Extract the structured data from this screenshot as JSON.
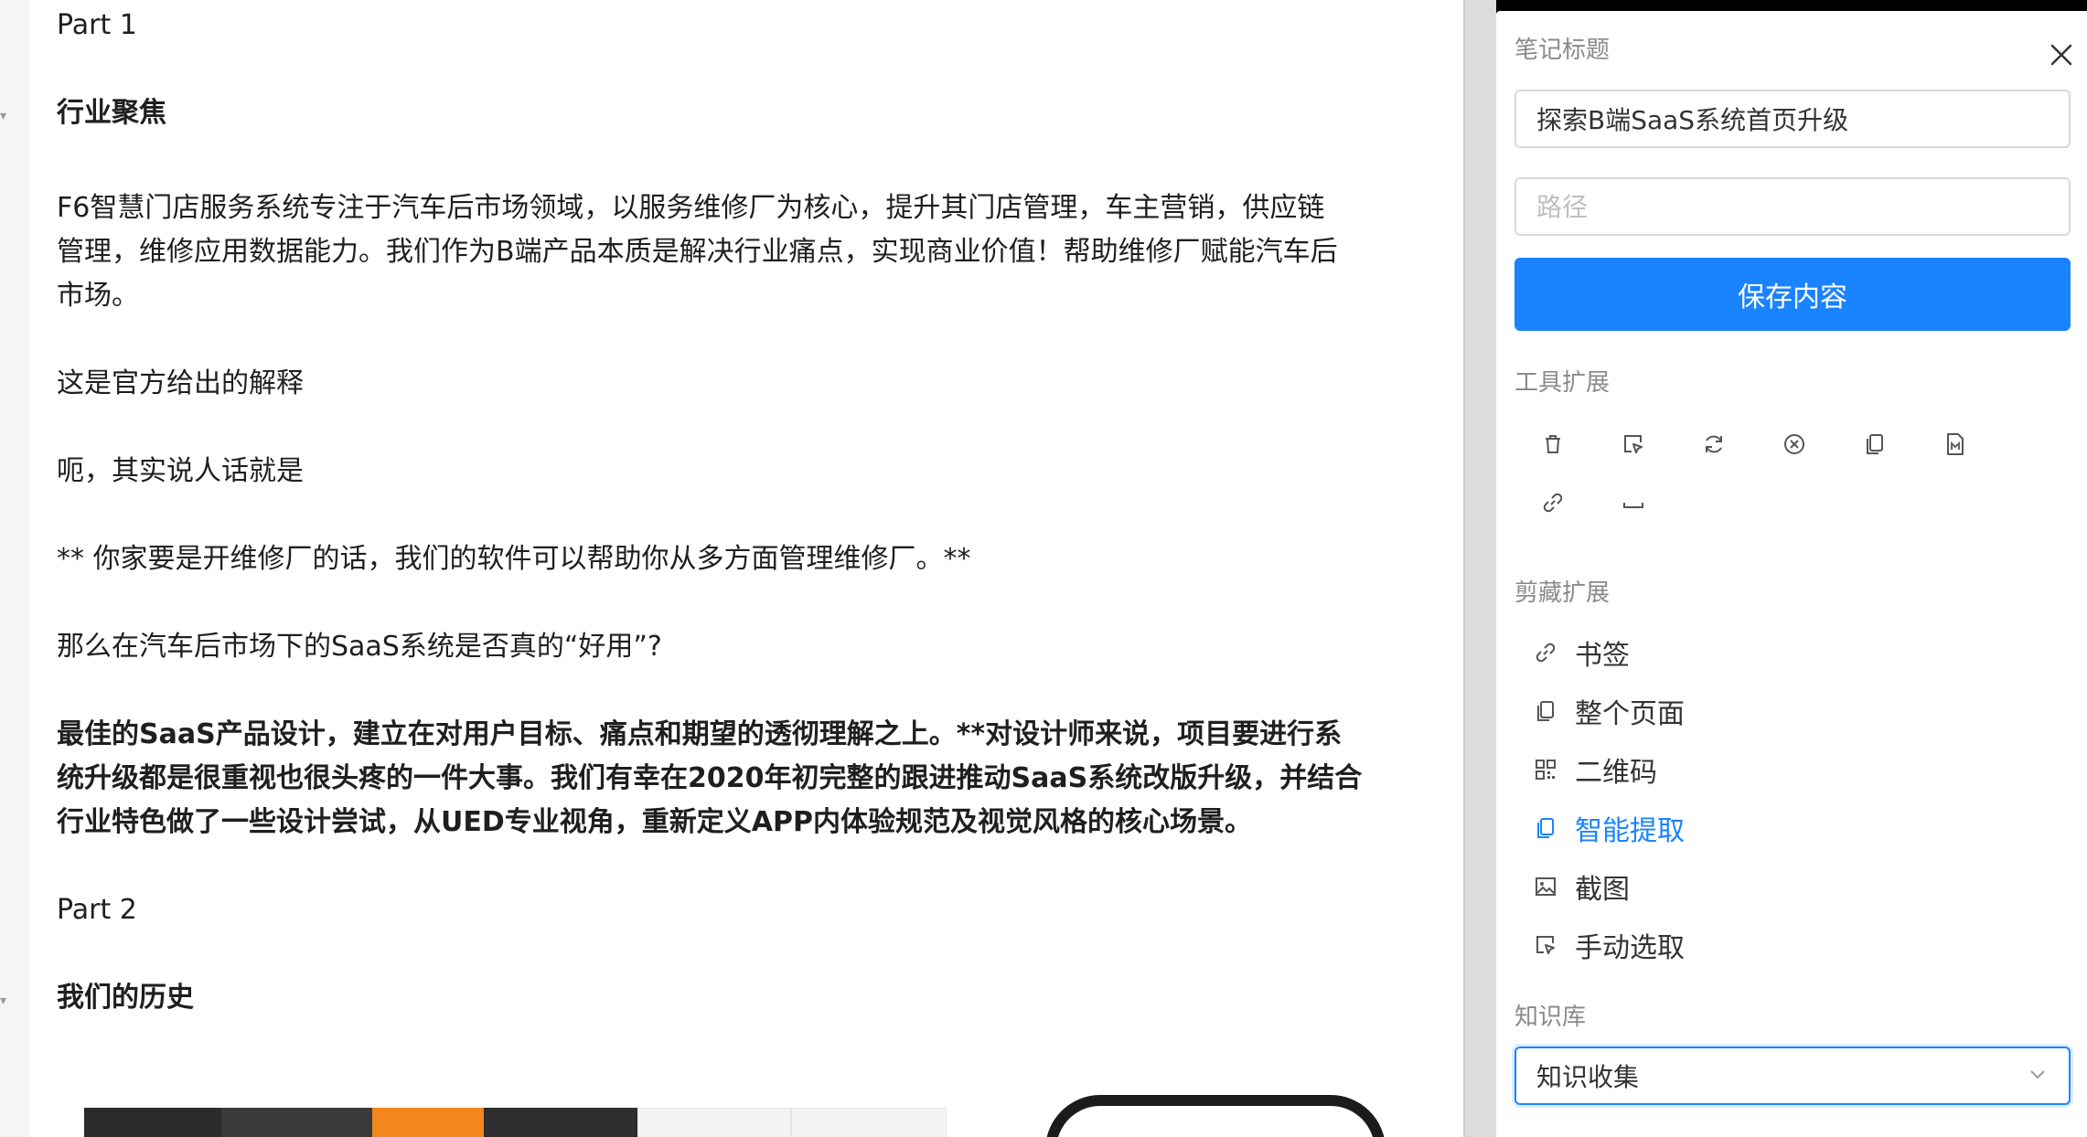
{
  "doc": {
    "part1": "Part 1",
    "heading1": "行业聚焦",
    "para1_line1": "F6智慧门店服务系统专注于汽车后市场领域，以服务维修厂为核心，提升其门店管理，车主营销，供应链",
    "para1_line2": "管理，维修应用数据能力。我们作为B端产品本质是解决行业痛点，实现商业价值！帮助维修厂赋能汽车后",
    "para1_line3": "市场。",
    "para2": "这是官方给出的解释",
    "para3": "呃，其实说人话就是",
    "para4": "** 你家要是开维修厂的话，我们的软件可以帮助你从多方面管理维修厂。**",
    "para5": "那么在汽车后市场下的SaaS系统是否真的“好用”?",
    "para6_line1": "最佳的SaaS产品设计，建立在对用户目标、痛点和期望的透彻理解之上。**对设计师来说，项目要进行系",
    "para6_line2": "统升级都是很重视也很头疼的一件大事。我们有幸在2020年初完整的跟进推动SaaS系统改版升级，并结合",
    "para6_line3": "行业特色做了一些设计尝试，从UED专业视角，重新定义APP内体验规范及视觉风格的核心场景。",
    "part2": "Part 2",
    "heading2": "我们的历史"
  },
  "panel": {
    "note_title_label": "笔记标题",
    "title_value": "探索B端SaaS系统首页升级",
    "path_placeholder": "路径",
    "save_label": "保存内容",
    "tools_label": "工具扩展",
    "tools": [
      "trash-icon",
      "select-area-icon",
      "refresh-icon",
      "clear-icon",
      "copy-icon",
      "markdown-icon",
      "link-icon",
      "space-icon"
    ],
    "clip_label": "剪藏扩展",
    "clip_items": [
      {
        "label": "书签",
        "icon": "link-icon"
      },
      {
        "label": "整个页面",
        "icon": "copy-icon"
      },
      {
        "label": "二维码",
        "icon": "qrcode-icon"
      },
      {
        "label": "智能提取",
        "icon": "copy-icon",
        "active": true
      },
      {
        "label": "截图",
        "icon": "image-icon"
      },
      {
        "label": "手动选取",
        "icon": "select-area-icon"
      }
    ],
    "kb_label": "知识库",
    "kb_value": "知识收集"
  },
  "colors": {
    "accent": "#1a83ff",
    "text": "#1f1f1f",
    "muted": "#8a8a8a"
  }
}
